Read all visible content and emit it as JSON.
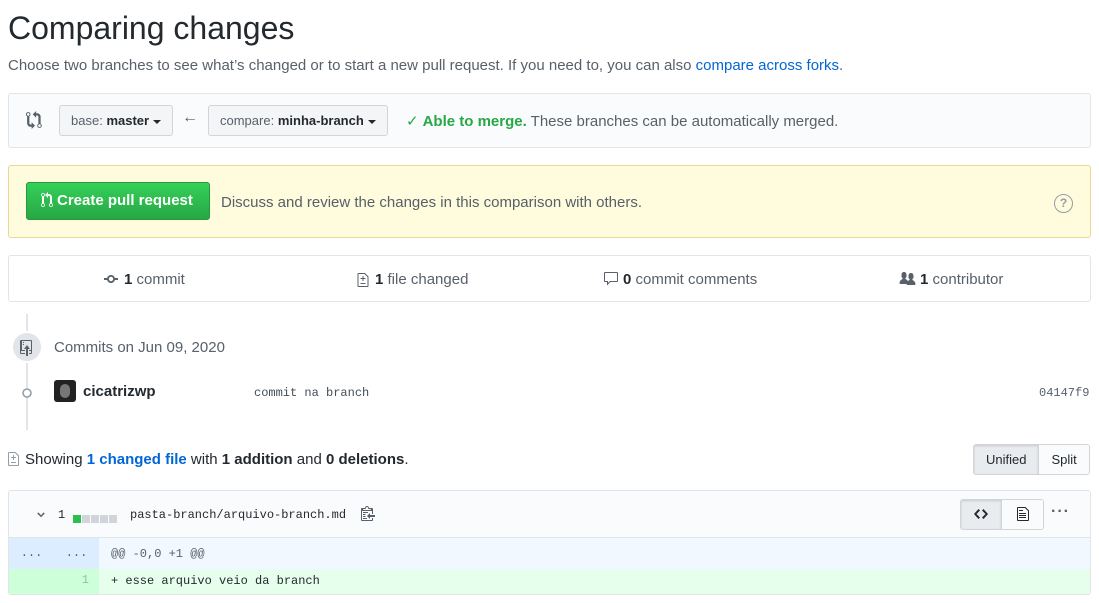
{
  "header": {
    "title": "Comparing changes",
    "subtitle_prefix": "Choose two branches to see what’s changed or to start a new pull request. If you need to, you can also ",
    "subtitle_link": "compare across forks",
    "subtitle_suffix": "."
  },
  "range": {
    "base_label": "base:",
    "base_value": "master",
    "compare_label": "compare:",
    "compare_value": "minha-branch",
    "merge_status": "Able to merge.",
    "merge_detail": "These branches can be automatically merged."
  },
  "pull_request": {
    "button_label": "Create pull request",
    "description": "Discuss and review the changes in this comparison with others.",
    "help": "?"
  },
  "stats": {
    "commits_count": "1",
    "commits_label": "commit",
    "files_count": "1",
    "files_label": "file changed",
    "comments_count": "0",
    "comments_label": "commit comments",
    "contributors_count": "1",
    "contributors_label": "contributor"
  },
  "commits": {
    "date_heading": "Commits on Jun 09, 2020",
    "items": [
      {
        "author": "cicatrizwp",
        "message": "commit na branch",
        "sha": "04147f9"
      }
    ]
  },
  "summary": {
    "prefix": "Showing ",
    "files_link": "1 changed file",
    "with": " with ",
    "additions": "1 addition",
    "and": " and ",
    "deletions": "0 deletions",
    "suffix": "."
  },
  "view_toggle": {
    "unified": "Unified",
    "split": "Split"
  },
  "file": {
    "changes": "1",
    "path": "pasta-branch/arquivo-branch.md",
    "hunk_left": "...",
    "hunk_right": "...",
    "hunk_header": "@@ -0,0 +1 @@",
    "line_number": "1",
    "line_content": "+ esse arquivo veio da branch"
  },
  "colors": {
    "accent_green": "#2cbe4e",
    "link_blue": "#0366d6",
    "warning_bg": "#fffbdd",
    "addition_bg": "#e6ffed"
  }
}
